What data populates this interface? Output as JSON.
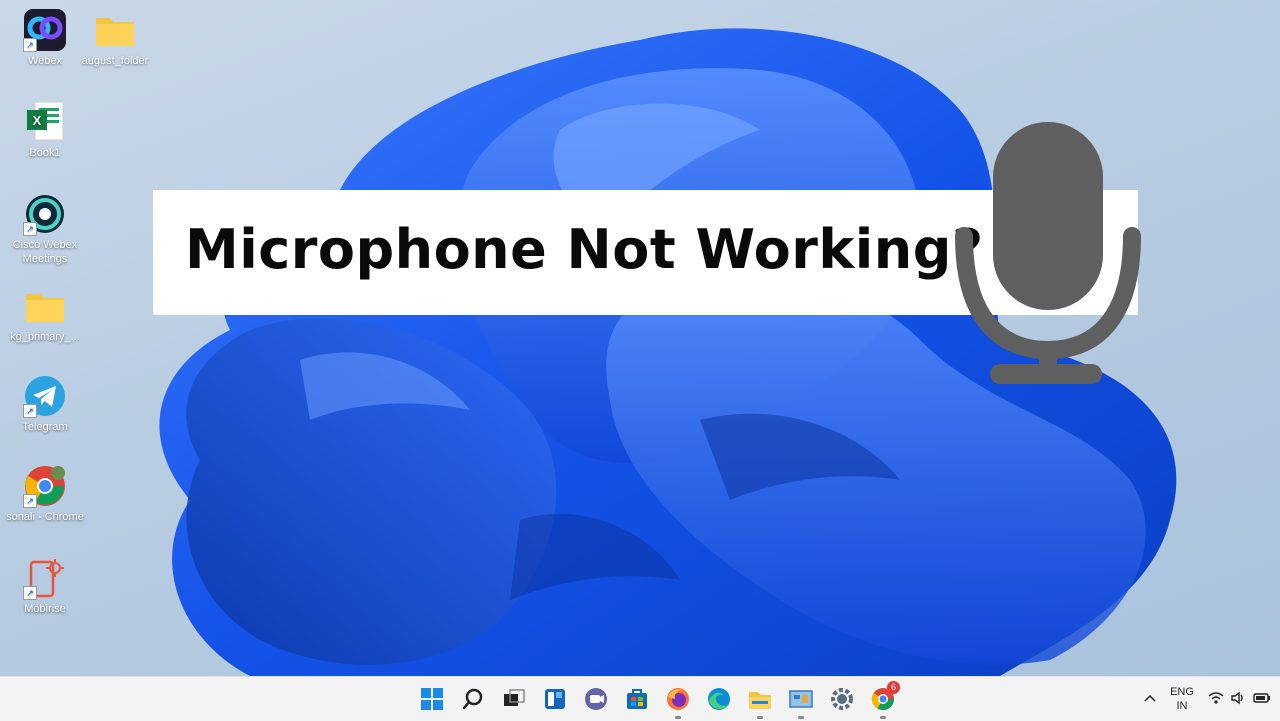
{
  "desktop": {
    "icons": [
      {
        "label": "Webex",
        "icon": "webex-icon"
      },
      {
        "label": "august_folder",
        "icon": "folder-icon"
      },
      {
        "label": "Book1",
        "icon": "excel-icon"
      },
      {
        "label": "Cisco Webex Meetings",
        "icon": "webex-meetings-icon"
      },
      {
        "label": "kg_primary_...",
        "icon": "folder-icon"
      },
      {
        "label": "Telegram",
        "icon": "telegram-icon"
      },
      {
        "label": "sonali - Chrome",
        "icon": "chrome-icon"
      },
      {
        "label": "Mobirise",
        "icon": "mobirise-icon"
      }
    ]
  },
  "banner": {
    "title": "Microphone Not Working?"
  },
  "taskbar": {
    "items": [
      "start-icon",
      "search-icon",
      "task-view-icon",
      "widgets-icon",
      "teams-chat-icon",
      "store-icon",
      "firefox-icon",
      "edge-icon",
      "file-explorer-icon",
      "control-panel-icon",
      "settings-icon",
      "chrome-icon"
    ],
    "chrome_badge": "6"
  },
  "tray": {
    "lang_line1": "ENG",
    "lang_line2": "IN"
  },
  "colors": {
    "wallpaper_blue": "#1a5cf0",
    "banner_bg": "#ffffff",
    "mic_gray": "#5f5f5f",
    "taskbar_bg": "#f3f3f3"
  }
}
